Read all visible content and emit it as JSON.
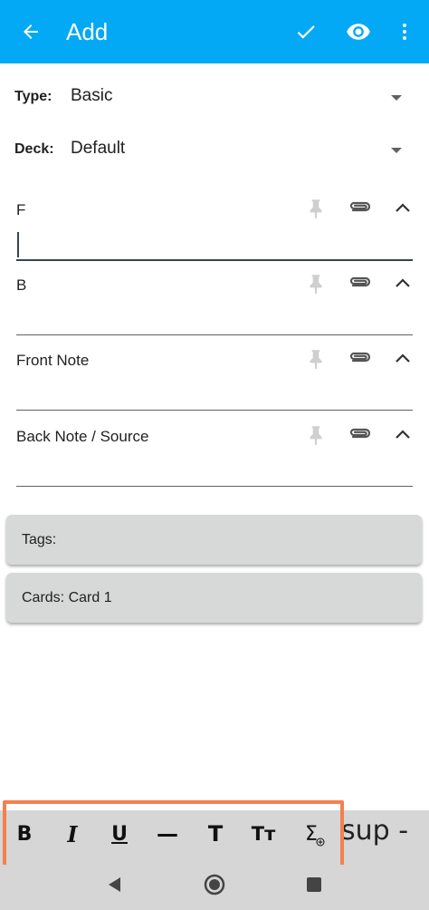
{
  "appbar": {
    "title": "Add",
    "background": "#03A9F4",
    "icons": [
      "back-arrow-icon",
      "checkmark-icon",
      "eye-icon",
      "more-vert-icon"
    ]
  },
  "selectors": {
    "type_label": "Type:",
    "type_value": "Basic",
    "deck_label": "Deck:",
    "deck_value": "Default"
  },
  "fields": [
    {
      "name": "F",
      "value": ""
    },
    {
      "name": "B",
      "value": ""
    },
    {
      "name": "Front Note",
      "value": ""
    },
    {
      "name": "Back Note / Source",
      "value": ""
    }
  ],
  "tags_label": "Tags:",
  "cards_label": "Cards: Card 1",
  "toolbar": {
    "buttons": [
      "bold-icon",
      "italic-icon",
      "underline-icon",
      "horizontal-rule-icon",
      "title-icon",
      "font-size-icon",
      "insert-mathjax-icon"
    ],
    "bold": "B",
    "italic": "I",
    "underline": "U",
    "hr": "—",
    "title": "T",
    "font_size": "Tт",
    "mathjax": "Σ",
    "overflow_text": "sup -",
    "highlight_color": "#F4804F"
  },
  "navbar": {
    "icons": [
      "nav-back-icon",
      "nav-home-icon",
      "nav-recents-icon"
    ]
  }
}
